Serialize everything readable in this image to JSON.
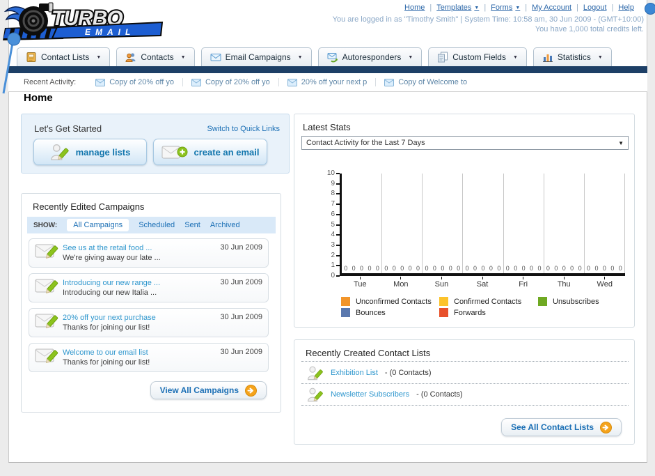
{
  "page_title": "Home",
  "logo": {
    "brand_top": "TURBO",
    "brand_bottom": "EMAIL"
  },
  "header": {
    "links": [
      {
        "label": "Home",
        "dropdown": false
      },
      {
        "label": "Templates",
        "dropdown": true
      },
      {
        "label": "Forms",
        "dropdown": true
      },
      {
        "label": "My Account",
        "dropdown": false
      },
      {
        "label": "Logout",
        "dropdown": false
      },
      {
        "label": "Help",
        "dropdown": false
      }
    ],
    "login_line": "You are logged in as \"Timothy Smith\" | System Time: 10:58 am, 30 Jun 2009 - (GMT+10:00)",
    "credits_line": "You have 1,000 total credits left."
  },
  "nav_tabs": [
    {
      "label": "Contact Lists",
      "icon": "address-book-icon"
    },
    {
      "label": "Contacts",
      "icon": "people-icon"
    },
    {
      "label": "Email Campaigns",
      "icon": "envelope-icon"
    },
    {
      "label": "Autoresponders",
      "icon": "envelope-arrow-icon"
    },
    {
      "label": "Custom Fields",
      "icon": "pages-icon"
    },
    {
      "label": "Statistics",
      "icon": "bar-chart-icon"
    }
  ],
  "recent_activity": {
    "label": "Recent Activity:",
    "items": [
      "Copy of 20% off yo",
      "Copy of 20% off yo",
      "20% off your next p",
      "Copy of Welcome to"
    ]
  },
  "get_started": {
    "title": "Let's Get Started",
    "switch_link": "Switch to Quick Links",
    "buttons": [
      {
        "label": "manage lists",
        "icon": "person-pencil-icon"
      },
      {
        "label": "create an email",
        "icon": "envelope-plus-icon"
      }
    ]
  },
  "campaigns": {
    "title": "Recently Edited Campaigns",
    "show_label": "SHOW:",
    "filters": [
      "All Campaigns",
      "Scheduled",
      "Sent",
      "Archived"
    ],
    "active_filter": "All Campaigns",
    "items": [
      {
        "title": "See us at the retail food ...",
        "subtitle": "We're giving away our late ...",
        "date": "30 Jun 2009"
      },
      {
        "title": "Introducing our new range ...",
        "subtitle": "Introducing our new Italia ...",
        "date": "30 Jun 2009"
      },
      {
        "title": "20% off your next purchase",
        "subtitle": "Thanks for joining our list!",
        "date": "30 Jun 2009"
      },
      {
        "title": "Welcome to our email list",
        "subtitle": "Thanks for joining our list!",
        "date": "30 Jun 2009"
      }
    ],
    "view_all_label": "View All Campaigns"
  },
  "stats": {
    "title": "Latest Stats",
    "period_selected": "Contact Activity for the Last 7 Days"
  },
  "chart_data": {
    "type": "bar",
    "title": "Contact Activity for the Last 7 Days",
    "categories": [
      "Tue",
      "Mon",
      "Sun",
      "Sat",
      "Fri",
      "Thu",
      "Wed"
    ],
    "series": [
      {
        "name": "Unconfirmed Contacts",
        "color": "#f2952a",
        "values": [
          0,
          0,
          0,
          0,
          0,
          0,
          0
        ]
      },
      {
        "name": "Confirmed Contacts",
        "color": "#fcc32b",
        "values": [
          0,
          0,
          0,
          0,
          0,
          0,
          0
        ]
      },
      {
        "name": "Unsubscribes",
        "color": "#6fa922",
        "values": [
          0,
          0,
          0,
          0,
          0,
          0,
          0
        ]
      },
      {
        "name": "Bounces",
        "color": "#5a78ae",
        "values": [
          0,
          0,
          0,
          0,
          0,
          0,
          0
        ]
      },
      {
        "name": "Forwards",
        "color": "#e8512b",
        "values": [
          0,
          0,
          0,
          0,
          0,
          0,
          0
        ]
      }
    ],
    "ylim": [
      0,
      10
    ],
    "ytick_step": 1,
    "grid": "vertical",
    "legend_position": "bottom",
    "value_labels_shown": true
  },
  "contact_lists": {
    "title": "Recently Created Contact Lists",
    "items": [
      {
        "name": "Exhibition List",
        "meta": "- (0 Contacts)"
      },
      {
        "name": "Newsletter Subscribers",
        "meta": "- (0 Contacts)"
      }
    ],
    "see_all_label": "See All Contact Lists"
  }
}
